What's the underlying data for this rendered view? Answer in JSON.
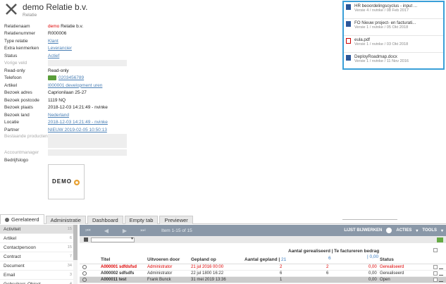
{
  "header": {
    "title": "demo Relatie b.v.",
    "subtitle": "Relatie"
  },
  "details": {
    "relatienaam_label": "Relatienaam",
    "relatienaam_red": "demo",
    "relatienaam_rest": "Relatie b.v.",
    "relatienummer_label": "Relatienummer",
    "relatienummer": "R000006",
    "type_label": "Type relatie",
    "type": "Klant",
    "extra_label": "Extra kenmerken",
    "extra": "Leverancier",
    "status_label": "Status",
    "status": "Actief",
    "vorige_label": "Vorige veld",
    "readonly_label": "Read-only",
    "readonly": "Read-only",
    "telefoon_label": "Telefoon",
    "telefoon": "0203456789",
    "artikel_label": "Artikel",
    "artikel": "I000001 development uren",
    "adres_label": "Bezoek adres",
    "adres": "Caprionilaan 25-27",
    "postcode_label": "Bezoek postcode",
    "postcode": "1119 NQ",
    "plaats_label": "Bezoek plaats",
    "plaats": "2018-12-03 14:21:49 - nvinke",
    "land_label": "Bezoek land",
    "land": "Nederland",
    "locatie_label": "Locatie",
    "locatie": "2018-12-03 14:21:49 - nvinke",
    "partner_label": "Partner",
    "partner": "NIEUW 2019-02-05 10:50:13",
    "bestaande_label": "Bestaande producten",
    "account_label": "Accountmanager",
    "bedrijfslogo_label": "Bedrijfslogo",
    "logo_text": "DEMO"
  },
  "documents": [
    {
      "name": "HR beoordelingscyclus - input ...",
      "meta": "Versie 4 / nvinke / 08 Feb 2017",
      "icon": "word"
    },
    {
      "name": "FO Nieuw project- en facturati...",
      "meta": "Versie 1 / nvinke / 05 Okt 2018",
      "icon": "word"
    },
    {
      "name": "eula.pdf",
      "meta": "Versie 1 / nvinke / 03 Okt 2018",
      "icon": "pdf"
    },
    {
      "name": "DeployRoadmap.docx",
      "meta": "Versie 1 / nvinke / 11 Nov 2016",
      "icon": "word"
    }
  ],
  "tabs": [
    "Gerelateerd",
    "Administratie",
    "Dashboard",
    "Empty tab",
    "Previewer"
  ],
  "left_list": [
    {
      "label": "Activiteit",
      "count": "15"
    },
    {
      "label": "Artikel",
      "count": "6"
    },
    {
      "label": "Contactpersoon",
      "count": "15"
    },
    {
      "label": "Contract",
      "count": "7"
    },
    {
      "label": "Document",
      "count": "34"
    },
    {
      "label": "Email",
      "count": "3"
    },
    {
      "label": "Gebruikers-Object",
      "count": "4"
    }
  ],
  "toolbar": {
    "nav_first": "⏮",
    "nav_prev": "◀",
    "nav_next": "▶",
    "nav_last": "⏭",
    "range": "Item 1-15 of 15",
    "lijst": "LIJST BIJWERKEN",
    "acties": "ACTIES",
    "tools": "TOOLS"
  },
  "columns": {
    "titel": "Titel",
    "uitvoeren": "Uitvoeren door",
    "gepland_op": "Gepland op",
    "aantal_gepland": "Aantal gepland |",
    "aantal_gepland_n": "21",
    "aantal_gereal": "Aantal gerealiseerd |",
    "aantal_gereal_n": "6",
    "te_factureren": "Te factureren bedrag",
    "te_factureren_n": "| 0,00",
    "status": "Status"
  },
  "rows": [
    {
      "titel": "A000001 sdfdsfsd",
      "door": "Administrator",
      "op": "21 jul 2016 00:00",
      "gepland": "2",
      "gereal": "2",
      "bedrag": "0,00",
      "status": "Gerealiseerd",
      "red": true
    },
    {
      "titel": "A000002 sdfsdfs",
      "door": "Administrator",
      "op": "22 jul 1800 16:22",
      "gepland": "6",
      "gereal": "6",
      "bedrag": "0,00",
      "status": "Gerealiseerd",
      "red": false
    },
    {
      "titel": "A000011 test",
      "door": "Frank Bunck",
      "op": "31 mei 2019 13:36",
      "gepland": "1",
      "gereal": "",
      "bedrag": "0,00",
      "status": "Open",
      "red": false
    }
  ]
}
